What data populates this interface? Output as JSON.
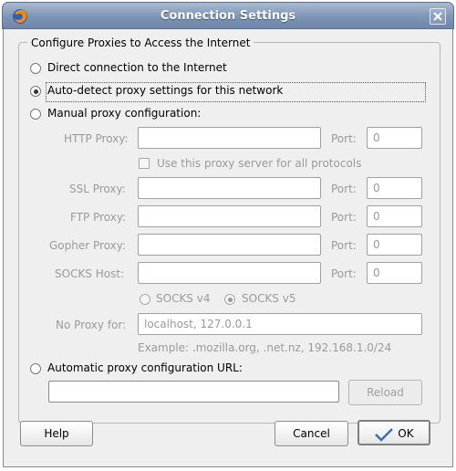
{
  "window": {
    "title": "Connection Settings"
  },
  "group": {
    "label": "Configure Proxies to Access the Internet"
  },
  "options": {
    "direct": "Direct connection to the Internet",
    "auto_detect": "Auto-detect proxy settings for this network",
    "manual": "Manual proxy configuration:",
    "auto_url": "Automatic proxy configuration URL:"
  },
  "selected_option": "auto_detect",
  "manual": {
    "http_label": "HTTP Proxy:",
    "ssl_label": "SSL Proxy:",
    "ftp_label": "FTP Proxy:",
    "gopher_label": "Gopher Proxy:",
    "socks_label": "SOCKS Host:",
    "port_label": "Port:",
    "http_host": "",
    "http_port": "0",
    "ssl_host": "",
    "ssl_port": "0",
    "ftp_host": "",
    "ftp_port": "0",
    "gopher_host": "",
    "gopher_port": "0",
    "socks_host": "",
    "socks_port": "0",
    "use_same_label": "Use this proxy server for all protocols",
    "socks_v4": "SOCKS v4",
    "socks_v5": "SOCKS v5",
    "no_proxy_label": "No Proxy for:",
    "no_proxy_value": "localhost, 127.0.0.1",
    "example": "Example: .mozilla.org, .net.nz, 192.168.1.0/24"
  },
  "auto_url": {
    "value": "",
    "reload_label": "Reload"
  },
  "buttons": {
    "help": "Help",
    "cancel": "Cancel",
    "ok": "OK"
  }
}
